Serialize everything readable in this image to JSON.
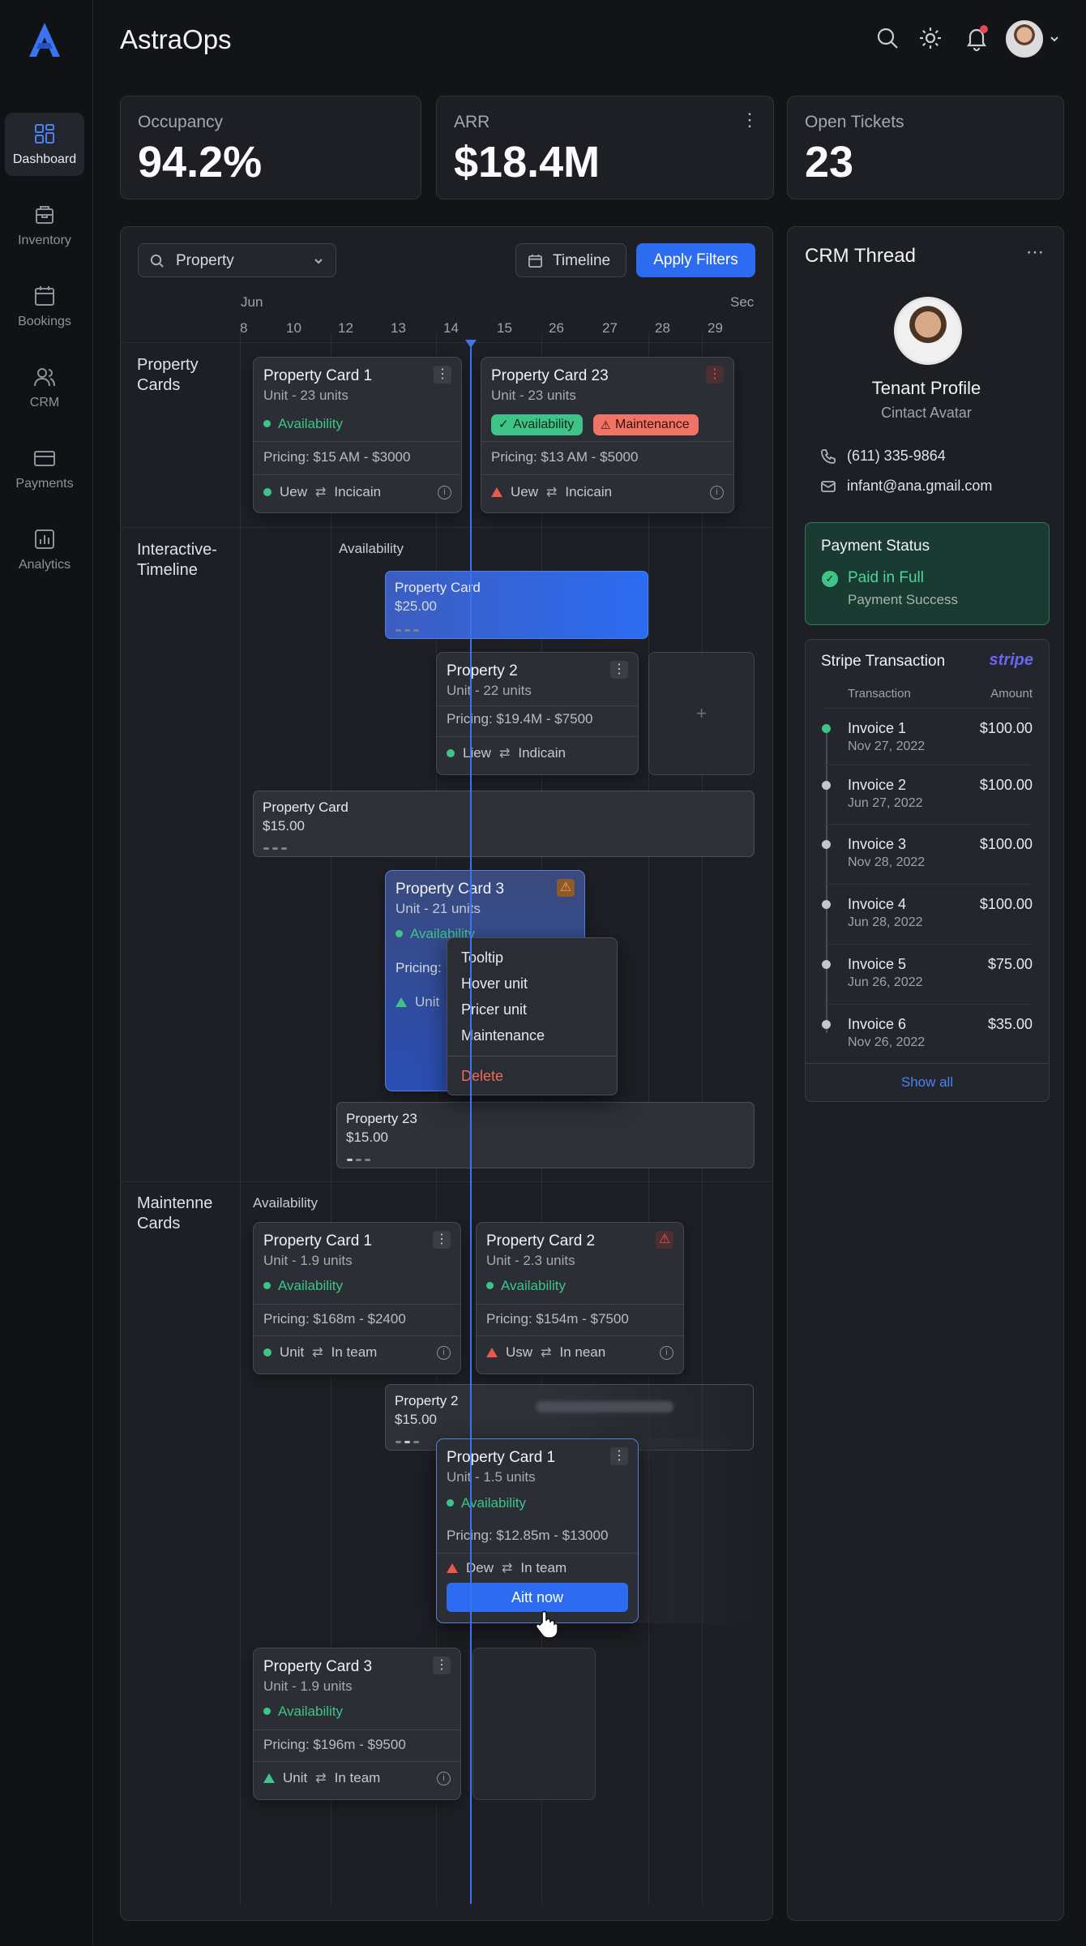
{
  "app": {
    "name": "AstraOps"
  },
  "sidebar": {
    "items": [
      {
        "label": "Dashboard",
        "icon": "dashboard-icon",
        "active": true
      },
      {
        "label": "Inventory",
        "icon": "inventory-icon"
      },
      {
        "label": "Bookings",
        "icon": "calendar-icon"
      },
      {
        "label": "CRM",
        "icon": "users-icon"
      },
      {
        "label": "Payments",
        "icon": "card-icon"
      },
      {
        "label": "Analytics",
        "icon": "analytics-icon"
      }
    ]
  },
  "header": {
    "notification_dot": "#e5484d"
  },
  "kpis": [
    {
      "label": "Occupancy",
      "value": "94.2%"
    },
    {
      "label": "ARR",
      "value": "$18.4M"
    },
    {
      "label": "Open Tickets",
      "value": "23"
    }
  ],
  "filters": {
    "property": "Property",
    "timeline": "Timeline",
    "apply": "Apply Filters"
  },
  "timeline": {
    "month_start": "Jun",
    "month_end": "Sec",
    "days": [
      "8",
      "10",
      "12",
      "13",
      "14",
      "15",
      "26",
      "27",
      "28",
      "29"
    ],
    "lanes": [
      "Property\nCards",
      "Interactive-\nTimeline",
      "Maintenne\nCards"
    ],
    "availability_label_1": "Availability",
    "availability_label_2": "Availability"
  },
  "cards": {
    "pc1": {
      "title": "Property Card 1",
      "unit": "Unit - 23 units",
      "avail": "Availability",
      "pricing": "Pricing: $15 AM - $3000",
      "f1": "Uew",
      "f2": "Incicain"
    },
    "pc23": {
      "title": "Property Card 23",
      "unit": "Unit - 23 units",
      "badge1": "Availability",
      "badge2": "Maintenance",
      "pricing": "Pricing: $13 AM - $5000",
      "f1": "Uew",
      "f2": "Incicain"
    },
    "bar1": {
      "title": "Property Card",
      "price": "$25.00"
    },
    "p2": {
      "title": "Property 2",
      "unit": "Unit - 22 units",
      "pricing": "Pricing: $19.4M - $7500",
      "f1": "Liew",
      "f2": "Indicain"
    },
    "bar2": {
      "title": "Property Card",
      "price": "$15.00"
    },
    "pc3": {
      "title": "Property Card 3",
      "unit": "Unit - 21 units",
      "avail": "Availability",
      "pricing": "Pricing:",
      "f1": "Unit"
    },
    "bar3": {
      "title": "Property 23",
      "price": "$15.00"
    },
    "m1": {
      "title": "Property Card 1",
      "unit": "Unit - 1.9 units",
      "avail": "Availability",
      "pricing": "Pricing: $168m - $2400",
      "f1": "Unit",
      "f2": "In team"
    },
    "m2": {
      "title": "Property Card 2",
      "unit": "Unit - 2.3 units",
      "avail": "Availability",
      "pricing": "Pricing: $154m - $7500",
      "f1": "Usw",
      "f2": "In nean"
    },
    "bar4": {
      "title": "Property 2",
      "price": "$15.00"
    },
    "drag": {
      "title": "Property Card 1",
      "unit": "Unit - 1.5 units",
      "avail": "Availability",
      "pricing": "Pricing: $12.85m - $13000",
      "f1": "Dew",
      "f2": "In team",
      "button": "Aitt now"
    },
    "m3": {
      "title": "Property Card 3",
      "unit": "Unit - 1.9 units",
      "avail": "Availability",
      "pricing": "Pricing: $196m - $9500",
      "f1": "Unit",
      "f2": "In team"
    }
  },
  "context_menu": {
    "items": [
      "Tooltip",
      "Hover unit",
      "Pricer unit",
      "Maintenance"
    ],
    "delete": "Delete"
  },
  "crm": {
    "title": "CRM Thread",
    "profile_name": "Tenant Profile",
    "profile_sub": "Cintact Avatar",
    "phone": "(611) 335-9864",
    "email": "infant@ana.gmail.com",
    "payment": {
      "title": "Payment Status",
      "status": "Paid in Full",
      "sub": "Payment Success"
    },
    "stripe": {
      "title": "Stripe Transaction",
      "logo": "stripe",
      "col1": "Transaction",
      "col2": "Amount",
      "rows": [
        {
          "name": "Invoice 1",
          "date": "Nov 27, 2022",
          "amount": "$100.00",
          "active": true
        },
        {
          "name": "Invoice 2",
          "date": "Jun 27, 2022",
          "amount": "$100.00"
        },
        {
          "name": "Invoice 3",
          "date": "Nov 28, 2022",
          "amount": "$100.00"
        },
        {
          "name": "Invoice 4",
          "date": "Jun 28, 2022",
          "amount": "$100.00"
        },
        {
          "name": "Invoice 5",
          "date": "Jun 26, 2022",
          "amount": "$75.00"
        },
        {
          "name": "Invoice 6",
          "date": "Nov 26, 2022",
          "amount": "$35.00"
        }
      ],
      "show_all": "Show all"
    }
  },
  "colors": {
    "accent": "#2d6cf0",
    "success": "#3fc487",
    "danger": "#e8584b",
    "warning": "#e8913a"
  }
}
